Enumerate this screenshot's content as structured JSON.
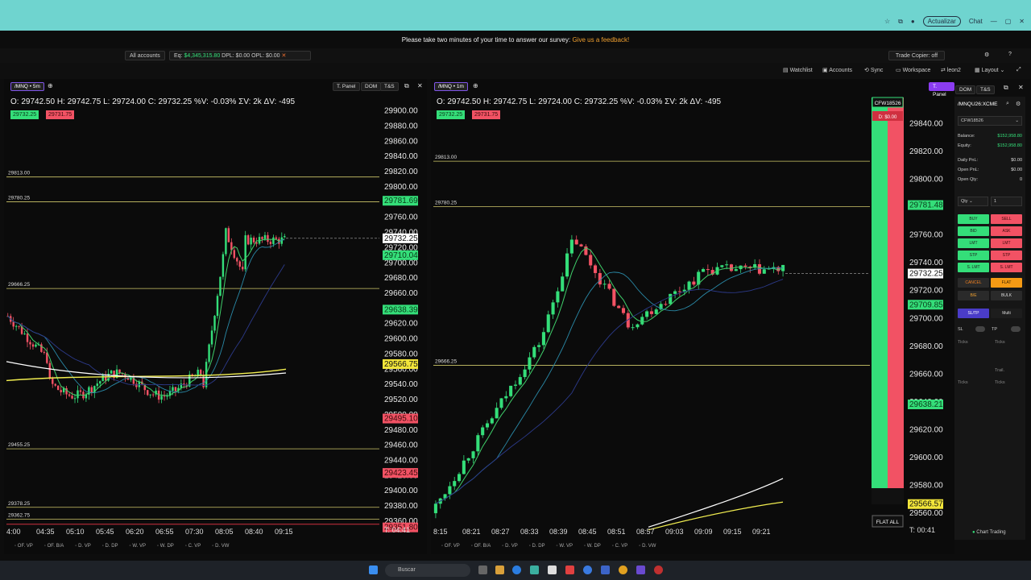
{
  "survey": {
    "text": "Please take two minutes of your time to answer our survey:",
    "link": "Give us a feedback!"
  },
  "browser": {
    "update": "Actualizar",
    "chat": "Chat"
  },
  "topbar": {
    "accounts": "All accounts",
    "eq": "Eq: ",
    "eq_value": "$4,345,315.80",
    "dpl": "DPL: $0.00",
    "opl": "OPL: $0.00",
    "trade_copier": "Trade Copier: off"
  },
  "toolbar": {
    "watchlist": "Watchlist",
    "accounts": "Accounts",
    "sync": "Sync",
    "workspace": "Workspace",
    "user": "leon2",
    "layout": "Layout"
  },
  "left": {
    "symbol": "/MNQ • 5m",
    "tpanel": "T. Panel",
    "dom": "DOM",
    "ts": "T&S",
    "ohlc": "O: 29742.50  H: 29742.75  L: 29724.00  C: 29732.25  %V: -0.03%  ΣV: 2k  ΔV: -495",
    "bid": "29732.25",
    "ask": "29731.75",
    "levels": [
      "29813.00",
      "29780.25",
      "29666.25",
      "29455.25",
      "29378.25",
      "29362.75"
    ],
    "prices": [
      "29900.00",
      "29880.00",
      "29860.00",
      "29840.00",
      "29820.00",
      "29800.00",
      "29780.00",
      "29760.00",
      "29740.00",
      "29720.00",
      "29700.00",
      "29680.00",
      "29660.00",
      "29640.00",
      "29620.00",
      "29600.00",
      "29580.00",
      "29560.00",
      "29540.00",
      "29520.00",
      "29500.00",
      "29480.00",
      "29460.00",
      "29440.00",
      "29420.00",
      "29400.00",
      "29380.00",
      "29360.00"
    ],
    "tags": [
      "29781.69",
      "29732.25",
      "29710.04",
      "29638.39",
      "29566.75",
      "29495.10",
      "29423.45",
      "29351.80"
    ],
    "countdown": "T: 04:41",
    "times": [
      "4:00",
      "04:35",
      "05:10",
      "05:45",
      "06:20",
      "06:55",
      "07:30",
      "08:05",
      "08:40",
      "09:15"
    ]
  },
  "right": {
    "symbol": "/MNQ • 1m",
    "tpanel": "T. Panel",
    "dom": "DOM",
    "ts": "T&S",
    "ohlc": "O: 29742.50  H: 29742.75  L: 29724.00  C: 29732.25  %V: -0.03%  ΣV: 2k  ΔV: -495",
    "bid": "29732.25",
    "ask": "29731.75",
    "levels": [
      "29813.00",
      "29780.25",
      "29666.25"
    ],
    "prices": [
      "29840.00",
      "29820.00",
      "29800.00",
      "29780.00",
      "29760.00",
      "29740.00",
      "29720.00",
      "29700.00",
      "29680.00",
      "29660.00",
      "29640.00",
      "29620.00",
      "29600.00",
      "29580.00",
      "29560.00"
    ],
    "tags": [
      "29781.48",
      "29732.25",
      "29709.85",
      "29638.21",
      "29566.57"
    ],
    "countdown": "T: 00:41",
    "times": [
      "8:15",
      "08:21",
      "08:27",
      "08:33",
      "08:39",
      "08:45",
      "08:51",
      "08:57",
      "09:03",
      "09:09",
      "09:15",
      "09:21"
    ]
  },
  "dom": {
    "account": "CFW18526",
    "dpl": "D: $0.00",
    "flat_all": "FLAT ALL"
  },
  "trade": {
    "symbol": "/MNQU26:XCME",
    "account": "CFW18526",
    "balance_label": "Balance:",
    "balance": "$152,958.80",
    "equity_label": "Equity:",
    "equity": "$152,958.80",
    "daily_label": "Daily PnL:",
    "daily": "$0.00",
    "open_label": "Open PnL:",
    "open": "$0.00",
    "qty_label": "Open Qty:",
    "qty": "0",
    "qty_sel": "Qty",
    "qty_val": "1",
    "buy": "BUY",
    "sell": "SELL",
    "bid": "BID",
    "ask": "ASK",
    "lmt": "LMT",
    "stp": "STP",
    "slmt": "S. LMT",
    "cancel": "CANCEL",
    "flat": "FLAT",
    "be": "B/E",
    "bulk": "BULK",
    "sltp": "SL/TP",
    "multi": "Multi",
    "sl": "SL",
    "tp": "TP",
    "ticks": "Ticks",
    "trail": "Trail.",
    "footer": "Chart Trading"
  },
  "bottom": [
    "OF. VP",
    "OF. B/A",
    "D. VP",
    "D. DP",
    "W. VP",
    "W. DP",
    "C. VP",
    "D. VW"
  ],
  "taskbar": {
    "search": "Buscar"
  },
  "colors": {
    "up": "#34de79",
    "down": "#f25264",
    "accent": "#8b3cf0",
    "level": "#d8d47a"
  }
}
